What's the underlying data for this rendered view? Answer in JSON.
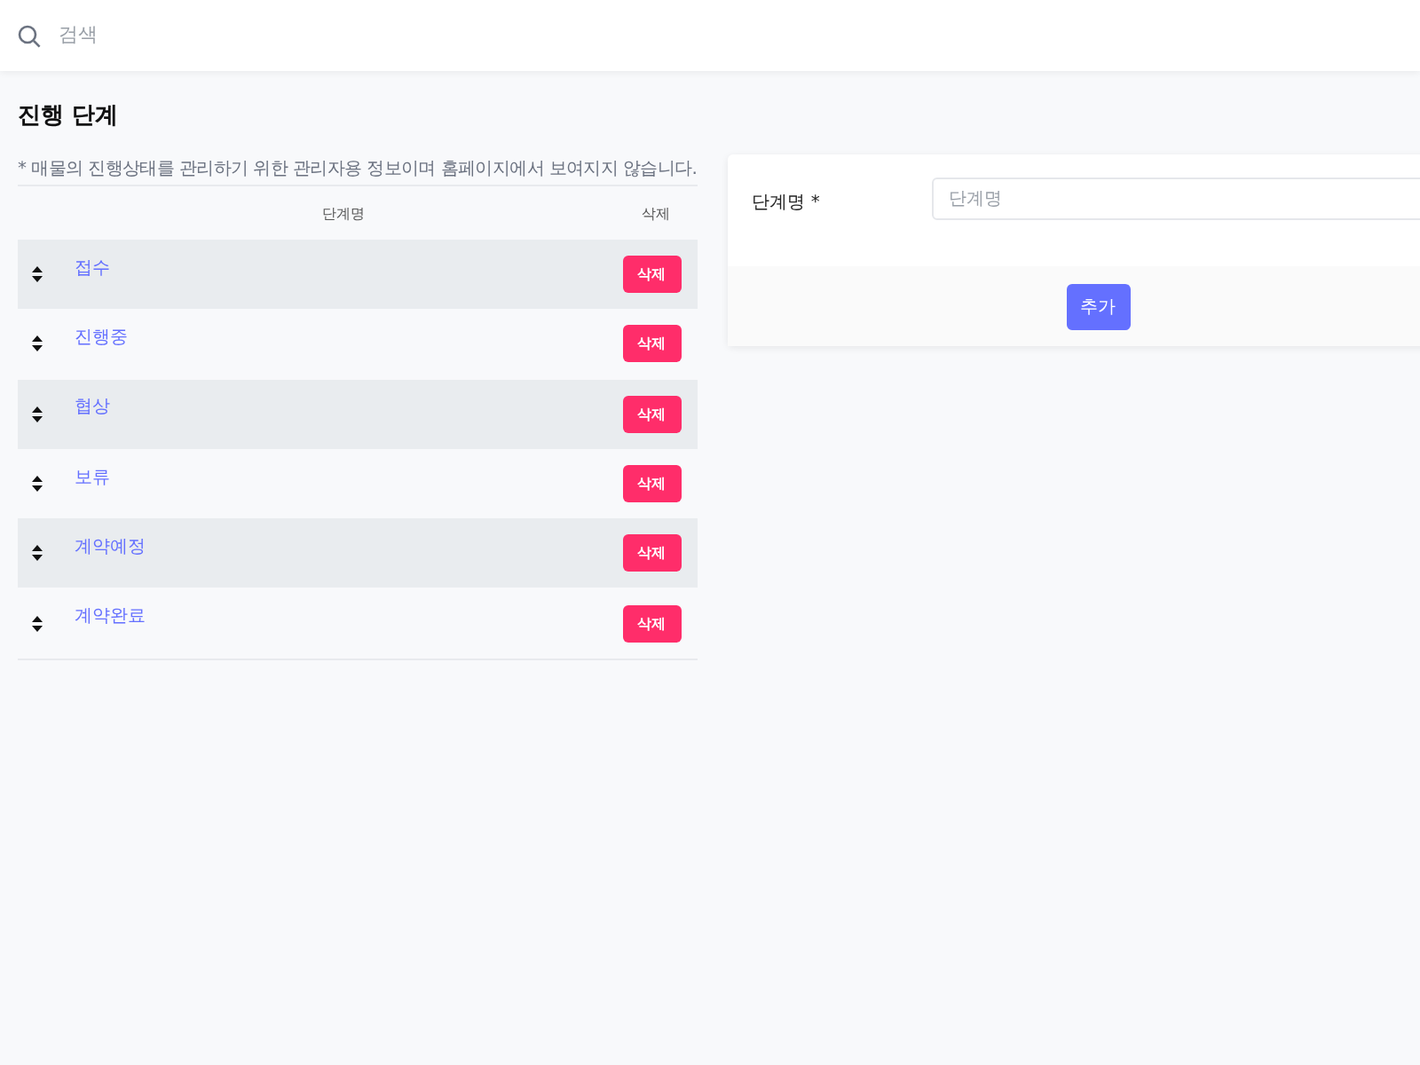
{
  "search": {
    "placeholder": "검색"
  },
  "page_title": "진행 단계",
  "note": "* 매물의 진행상태를 관리하기 위한 관리자용 정보이며 홈페이지에서 보여지지 않습니다.",
  "table": {
    "columns": [
      "단계명",
      "삭제"
    ],
    "rows": [
      {
        "name": "접수",
        "button": "삭제"
      },
      {
        "name": "진행중",
        "button": "삭제"
      },
      {
        "name": "협상",
        "button": "삭제"
      },
      {
        "name": "보류",
        "button": "삭제"
      },
      {
        "name": "계약예정",
        "button": "삭제"
      },
      {
        "name": "계약완료",
        "button": "삭제"
      }
    ]
  },
  "form": {
    "label": "단계명",
    "required_mark": "*",
    "field": {
      "placeholder": "단계명"
    },
    "submit": "추가"
  }
}
